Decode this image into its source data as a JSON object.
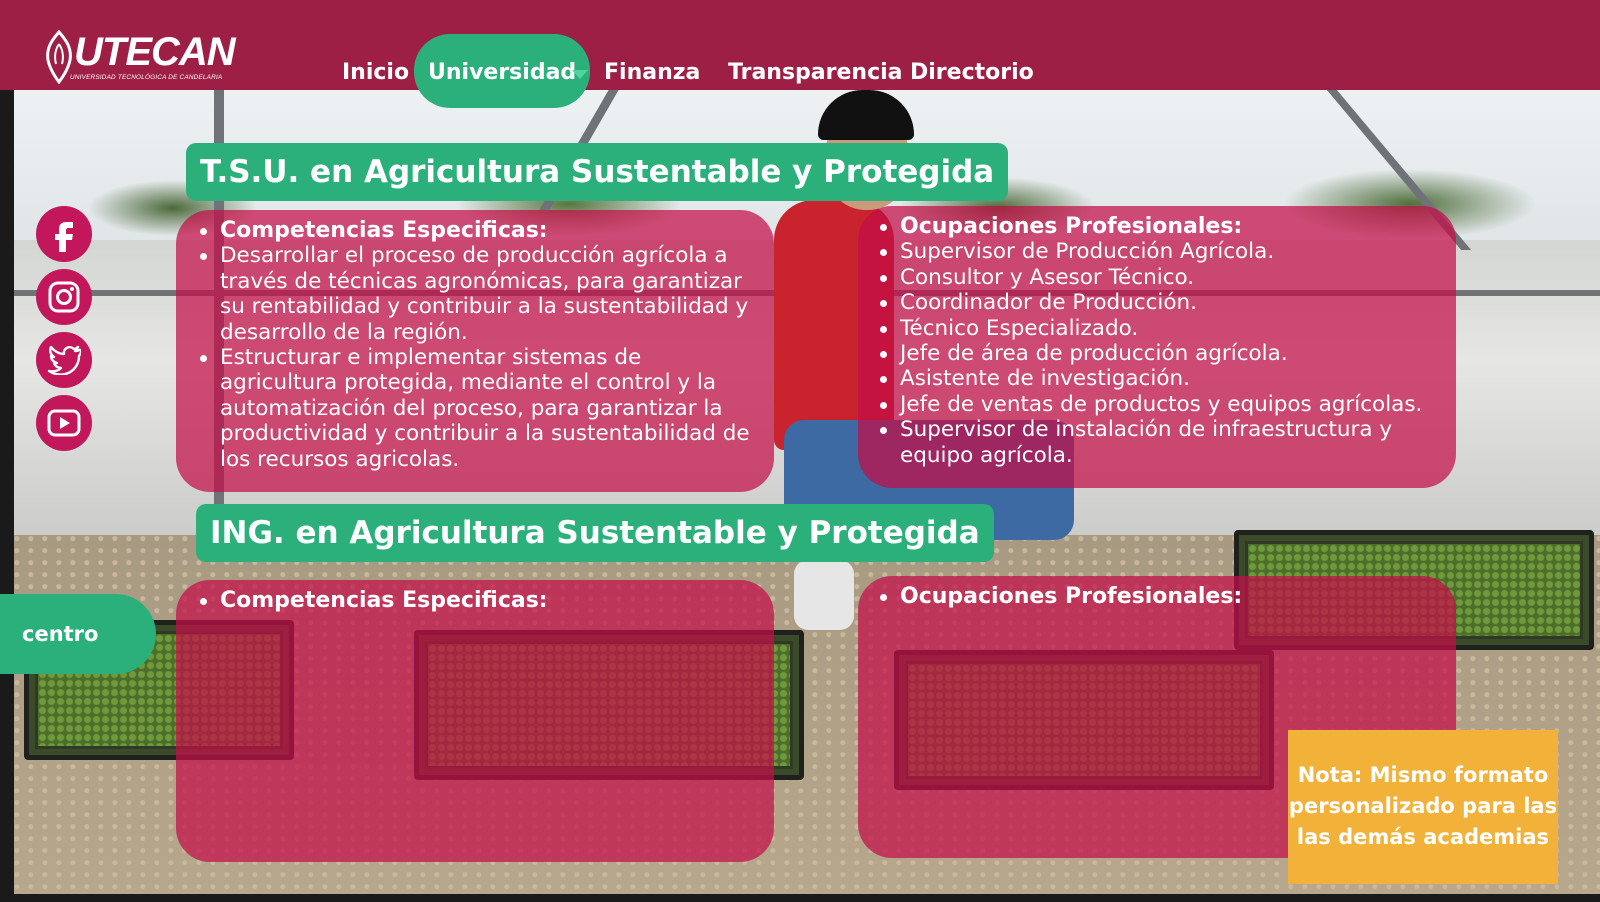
{
  "brand": {
    "name": "UTECAN",
    "subtitle": "UNIVERSIDAD TECNOLÓGICA DE CANDELARIA"
  },
  "nav": {
    "items": [
      "Inicio",
      "Universidad",
      "Finanza",
      "Transparencia",
      "Directorio"
    ],
    "active": "Universidad"
  },
  "social": [
    "facebook-icon",
    "instagram-icon",
    "twitter-icon",
    "youtube-icon"
  ],
  "sections": [
    {
      "title": "T.S.U. en Agricultura Sustentable y Protegida",
      "competencias": {
        "heading": "Competencias Especificas:",
        "items": [
          "Desarrollar el proceso de producción agrícola a través de técnicas agronómicas, para garantizar su rentabilidad y contribuir a la sustentabilidad y desarrollo de la región.",
          "Estructurar e implementar sistemas de agricultura protegida, mediante el control y la automatización del proceso, para garantizar la productividad y contribuir a la sustentabilidad de los recursos agricolas."
        ]
      },
      "ocupaciones": {
        "heading": "Ocupaciones Profesionales:",
        "items": [
          "Supervisor de Producción Agrícola.",
          "Consultor y Asesor Técnico.",
          "Coordinador de Producción.",
          "Técnico Especializado.",
          "Jefe de área de producción agrícola.",
          "Asistente de investigación.",
          "Jefe de ventas de productos y equipos agrícolas.",
          "Supervisor de instalación de infraestructura y equipo agrícola."
        ]
      }
    },
    {
      "title": "ING. en Agricultura Sustentable y Protegida",
      "competencias": {
        "heading": "Competencias Especificas:"
      },
      "ocupaciones": {
        "heading": "Ocupaciones Profesionales:"
      }
    }
  ],
  "side_tab": "centro",
  "note": {
    "line1": "Nota: Mismo formato",
    "line2": "personalizado para las",
    "line3": "las demás academias"
  },
  "colors": {
    "header": "#9e1f45",
    "accent_green": "#2bb07c",
    "panel": "#c40e48",
    "note": "#f2b23a"
  }
}
